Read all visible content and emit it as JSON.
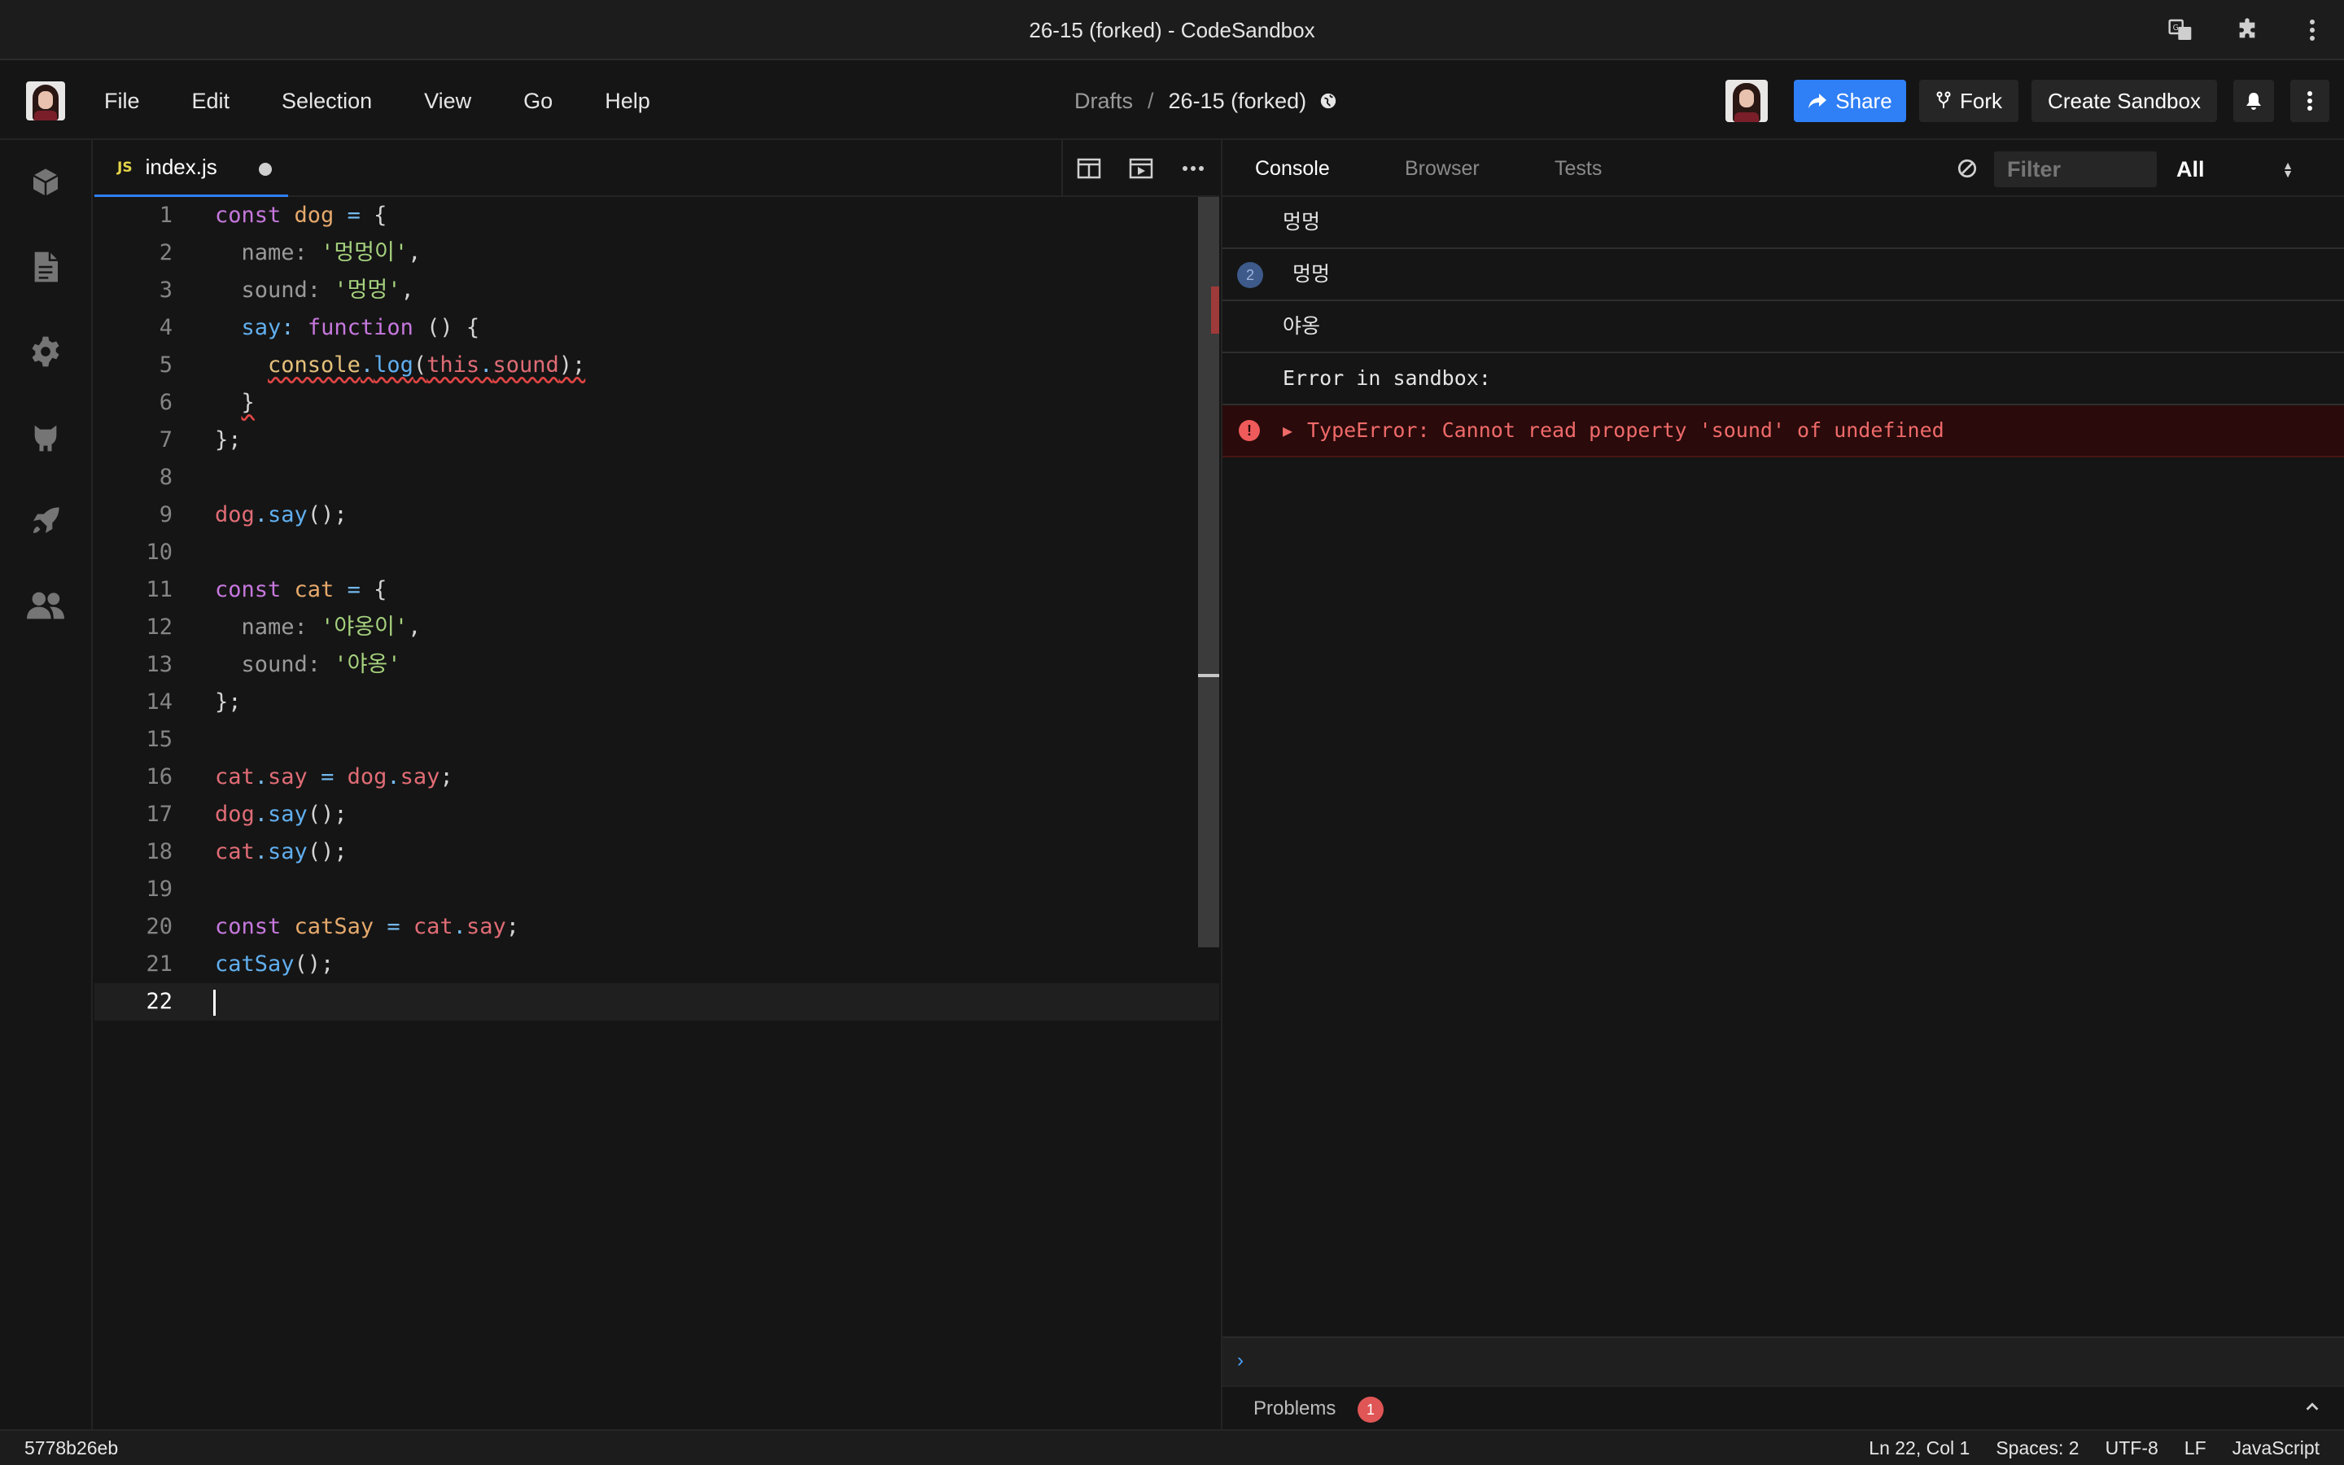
{
  "window": {
    "title": "26-15 (forked) - CodeSandbox"
  },
  "menu": {
    "items": [
      "File",
      "Edit",
      "Selection",
      "View",
      "Go",
      "Help"
    ]
  },
  "breadcrumb": {
    "folder": "Drafts",
    "separator": "/",
    "sandbox_name": "26-15 (forked)"
  },
  "header_buttons": {
    "share": "Share",
    "fork": "Fork",
    "create": "Create Sandbox"
  },
  "editor": {
    "tab": {
      "badge": "JS",
      "filename": "index.js",
      "unsaved": true
    },
    "current_line": 22,
    "lines": [
      "const dog = {",
      "  name: '멍멍이',",
      "  sound: '멍멍',",
      "  say: function () {",
      "    console.log(this.sound);",
      "  }",
      "};",
      "",
      "dog.say();",
      "",
      "const cat = {",
      "  name: '야옹이',",
      "  sound: '야옹'",
      "};",
      "",
      "cat.say = dog.say;",
      "dog.say();",
      "cat.say();",
      "",
      "const catSay = cat.say;",
      "catSay();",
      ""
    ]
  },
  "panel": {
    "tabs": [
      "Console",
      "Browser",
      "Tests"
    ],
    "active_tab": "Console",
    "filter_placeholder": "Filter",
    "level": "All",
    "logs": [
      {
        "text": "멍멍",
        "count": null
      },
      {
        "text": "멍멍",
        "count": "2"
      },
      {
        "text": "야옹",
        "count": null
      },
      {
        "text": "Error in sandbox:",
        "count": null
      }
    ],
    "error": "TypeError: Cannot read property 'sound' of undefined",
    "prompt": "›",
    "problems_label": "Problems",
    "problems_count": "1"
  },
  "statusbar": {
    "commit": "5778b26eb",
    "position": "Ln 22, Col 1",
    "spaces": "Spaces: 2",
    "encoding": "UTF-8",
    "eol": "LF",
    "language": "JavaScript"
  },
  "colors": {
    "accent": "#2f7ff6",
    "error": "#ef6a6a",
    "background": "#151515"
  }
}
